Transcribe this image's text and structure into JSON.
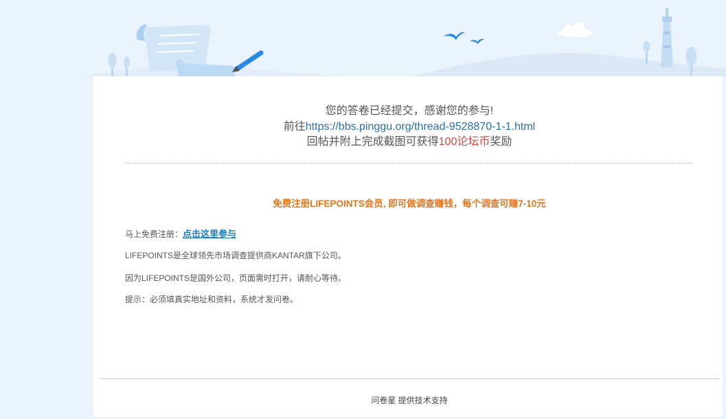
{
  "thanks": {
    "line1": "您的答卷已经提交，感谢您的参与!",
    "line2_prefix": "前往",
    "line2_link": "https://bbs.pinggu.org/thread-9528870-1-1.html",
    "line3_prefix": "回帖并附上完成截图可获得",
    "line3_highlight": "100论坛币",
    "line3_suffix": "奖励"
  },
  "promo": {
    "headline": "免费注册LIFEPOINTS会员, 即可做调查赚钱，每个调查可赚7-10元",
    "register_label": "马上免费注册：",
    "register_link": "点击这里参与",
    "info1": "LIFEPOINTS是全球领先市场调查提供商KANTAR旗下公司。",
    "info2": "因为LIFEPOINTS是国外公司，页面需时打开，请耐心等待。",
    "info3": "提示：必须填真实地址和资料，系统才发问卷。"
  },
  "footer": {
    "brand": "问卷星",
    "support": " 提供技术支持"
  },
  "colors": {
    "page_bg": "#eaf2fb",
    "link": "#2b6cb0",
    "highlight_red": "#e2413b",
    "promo_orange": "#e8731a",
    "register_link": "#1a7bc1"
  }
}
